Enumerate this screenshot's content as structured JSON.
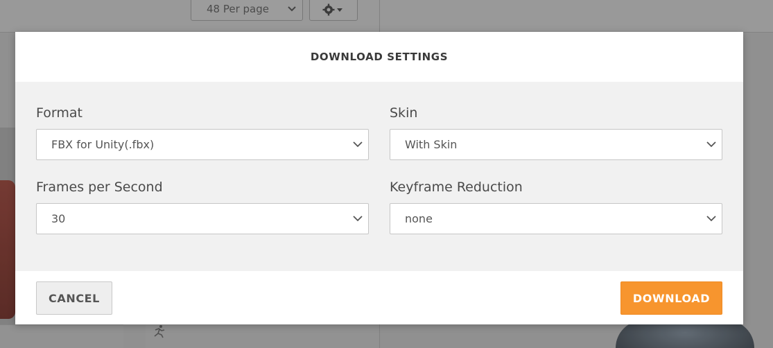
{
  "background": {
    "per_page_label": "48 Per page",
    "per_page_icon": "chevron-down-icon",
    "settings_icon": "gear-icon"
  },
  "modal": {
    "title": "DOWNLOAD SETTINGS",
    "fields": {
      "format": {
        "label": "Format",
        "value": "FBX for Unity(.fbx)"
      },
      "skin": {
        "label": "Skin",
        "value": "With Skin"
      },
      "fps": {
        "label": "Frames per Second",
        "value": "30"
      },
      "keyframe": {
        "label": "Keyframe Reduction",
        "value": "none"
      }
    },
    "buttons": {
      "cancel": "CANCEL",
      "download": "DOWNLOAD"
    }
  },
  "colors": {
    "accent": "#f7952e",
    "body_bg": "#f1f1f1",
    "overlay": "#9a9a9a"
  }
}
